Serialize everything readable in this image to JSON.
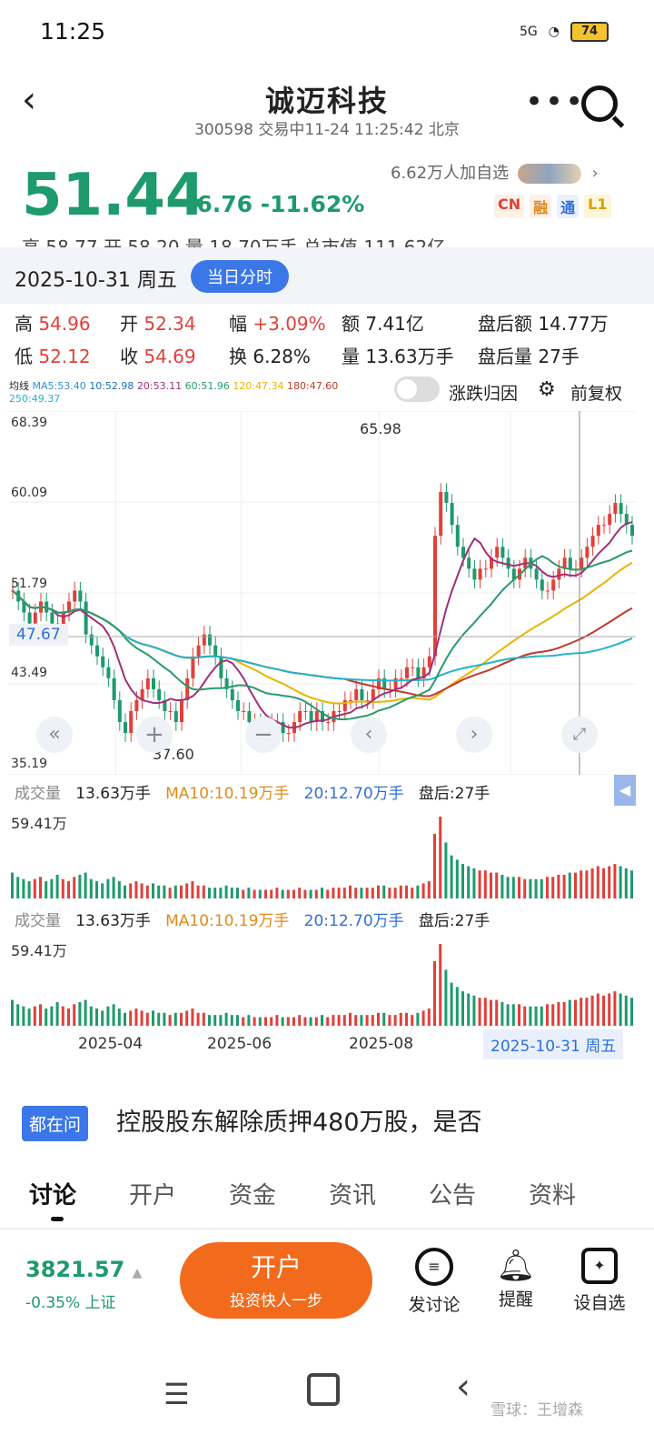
{
  "status": {
    "time": "11:25",
    "signal": "5G",
    "battery": "74"
  },
  "header": {
    "title": "诚迈科技",
    "subtitle": "300598 交易中11-24 11:25:42 北京"
  },
  "quote": {
    "price": "51.44",
    "change": "-6.76",
    "change_pct": "-11.62%",
    "watchers": "6.62万人加自选",
    "tags": [
      "CN",
      "融",
      "通",
      "L1"
    ],
    "cut_row": "高 58.77    开 58.20    量 18.70万手    总市值 111.62亿"
  },
  "popup": {
    "date": "2025-10-31 周五",
    "mode_pill": "当日分时",
    "stats": [
      {
        "label": "高",
        "value": "54.96",
        "color": "red"
      },
      {
        "label": "开",
        "value": "52.34",
        "color": "red"
      },
      {
        "label": "幅",
        "value": "+3.09%",
        "color": "red"
      },
      {
        "label": "额",
        "value": "7.41亿",
        "color": "dark"
      },
      {
        "label": "盘后额",
        "value": "14.77万",
        "color": "dark"
      },
      {
        "label": "低",
        "value": "52.12",
        "color": "red"
      },
      {
        "label": "收",
        "value": "54.69",
        "color": "red"
      },
      {
        "label": "换",
        "value": "6.28%",
        "color": "dark"
      },
      {
        "label": "量",
        "value": "13.63万手",
        "color": "dark"
      },
      {
        "label": "盘后量",
        "value": "27手",
        "color": "dark"
      }
    ],
    "ma_line": {
      "prefix": "均线",
      "items": [
        {
          "text": "MA5:53.40",
          "color": "#2f8fd6"
        },
        {
          "text": "10:52.98",
          "color": "#1f6db8"
        },
        {
          "text": "20:53.11",
          "color": "#a0307a"
        },
        {
          "text": "60:51.96",
          "color": "#2a9a6a"
        },
        {
          "text": "120:47.34",
          "color": "#e8b500"
        },
        {
          "text": "180:47.60",
          "color": "#c0392b"
        },
        {
          "text": "250:49.37",
          "color": "#22b5c9"
        }
      ]
    },
    "toggle_label": "涨跌归因",
    "fq_label": "前复权"
  },
  "chart_data": {
    "type": "candlestick",
    "y_ticks": [
      "68.39",
      "60.09",
      "51.79",
      "43.49",
      "35.19"
    ],
    "current_marker": "47.67",
    "high_marker": "65.98",
    "low_marker": "37.60",
    "x_ticks": [
      "2025-04",
      "2025-06",
      "2025-08"
    ],
    "crosshair_date": "2025-10-31 周五",
    "close_series": [
      52,
      51,
      50,
      49,
      50,
      51,
      50,
      49,
      48,
      50,
      51,
      52,
      51,
      48,
      47,
      46,
      45,
      44,
      42,
      40,
      39,
      41,
      42,
      43,
      44,
      43,
      42,
      41,
      41,
      40,
      42,
      44,
      46,
      47,
      48,
      47,
      46,
      44,
      43,
      42,
      41,
      41,
      40,
      40,
      39,
      39,
      40,
      40,
      39,
      39,
      40,
      41,
      41,
      40,
      41,
      40,
      40,
      41,
      41,
      42,
      42,
      43,
      42,
      42,
      43,
      44,
      43,
      43,
      44,
      44,
      45,
      45,
      44,
      45,
      46,
      57,
      61,
      60,
      58,
      56,
      55,
      54,
      53,
      54,
      54,
      55,
      56,
      55,
      54,
      53,
      54,
      55,
      54,
      53,
      52,
      52,
      53,
      54,
      55,
      54,
      54,
      55,
      56,
      57,
      58,
      58,
      59,
      60,
      59,
      58,
      57
    ],
    "volume_y_label": "59.41万",
    "volume_series": [
      12,
      10,
      9,
      8,
      9,
      10,
      8,
      9,
      11,
      9,
      8,
      10,
      11,
      12,
      9,
      8,
      7,
      9,
      10,
      8,
      6,
      7,
      8,
      7,
      6,
      7,
      6,
      6,
      5,
      6,
      6,
      7,
      8,
      6,
      6,
      5,
      5,
      5,
      6,
      5,
      5,
      4,
      5,
      4,
      4,
      4,
      4,
      5,
      4,
      4,
      4,
      5,
      4,
      4,
      4,
      5,
      4,
      5,
      5,
      5,
      6,
      5,
      5,
      5,
      5,
      6,
      6,
      5,
      5,
      6,
      6,
      5,
      6,
      7,
      8,
      30,
      38,
      26,
      20,
      18,
      16,
      15,
      14,
      13,
      13,
      12,
      12,
      11,
      10,
      10,
      10,
      9,
      9,
      9,
      9,
      10,
      10,
      11,
      11,
      12,
      12,
      13,
      13,
      14,
      15,
      14,
      15,
      16,
      15,
      14,
      13
    ]
  },
  "volume_panel": {
    "label": "成交量",
    "vol": "13.63万手",
    "ma10": "MA10:10.19万手",
    "ma20": "20:12.70万手",
    "after": "盘后:27手"
  },
  "ask": {
    "badge": "都在问",
    "text": "控股股东解除质押480万股，是否"
  },
  "tabs": [
    "讨论",
    "开户",
    "资金",
    "资讯",
    "公告",
    "资料"
  ],
  "index": {
    "value": "3821.57",
    "change": "-0.35%",
    "name": "上证"
  },
  "open_button": {
    "title": "开户",
    "sub": "投资快人一步"
  },
  "actions": [
    {
      "label": "发讨论",
      "icon": "chat-icon"
    },
    {
      "label": "提醒",
      "icon": "bell-icon"
    },
    {
      "label": "设自选",
      "icon": "star-add-icon"
    }
  ],
  "watermark": "雪球：王增森",
  "colors": {
    "up": "#e0403a",
    "down": "#1e9a6c",
    "accent": "#3c77e8",
    "orange": "#f26a1b"
  }
}
